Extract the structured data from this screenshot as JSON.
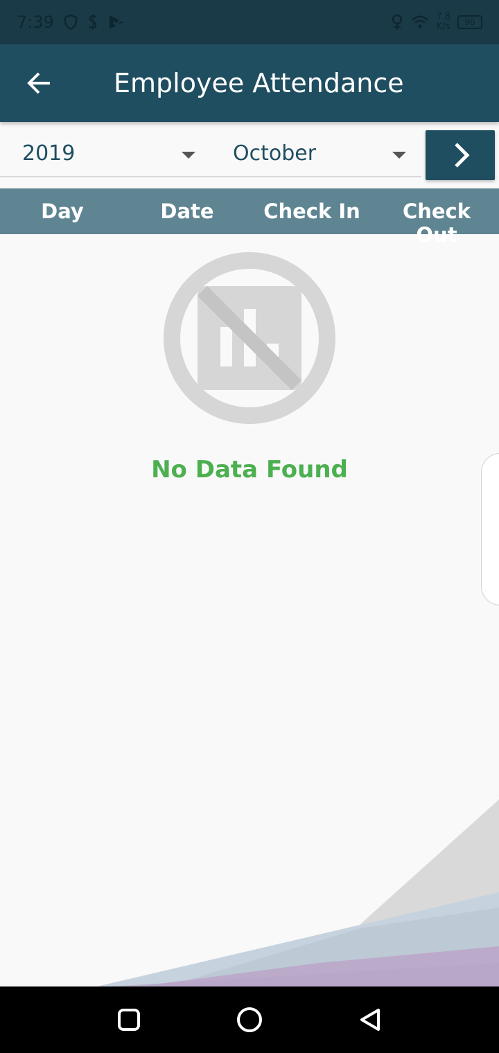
{
  "status_bar": {
    "time": "7:39",
    "net_speed_value": "7.8",
    "net_speed_unit": "K/s",
    "battery": "96",
    "icons": [
      "shield-icon",
      "s-notification-icon",
      "check-notification-icon",
      "location-icon",
      "wifi-icon"
    ]
  },
  "app_bar": {
    "title": "Employee Attendance",
    "back_icon": "arrow-left-icon"
  },
  "filters": {
    "year": "2019",
    "month": "October",
    "next_icon": "chevron-right-icon"
  },
  "table": {
    "columns": [
      "Day",
      "Date",
      "Check In",
      "Check Out"
    ]
  },
  "empty_state": {
    "message": "No Data Found",
    "icon": "no-chart-icon"
  },
  "colors": {
    "app_bar": "#1f4e60",
    "status_bar": "#1a3a48",
    "table_header": "#5f8592",
    "empty_text": "#4caf50",
    "background": "#f9f9f9"
  },
  "nav_bar": {
    "buttons": [
      "recent-apps-icon",
      "home-icon",
      "back-triangle-icon"
    ]
  }
}
